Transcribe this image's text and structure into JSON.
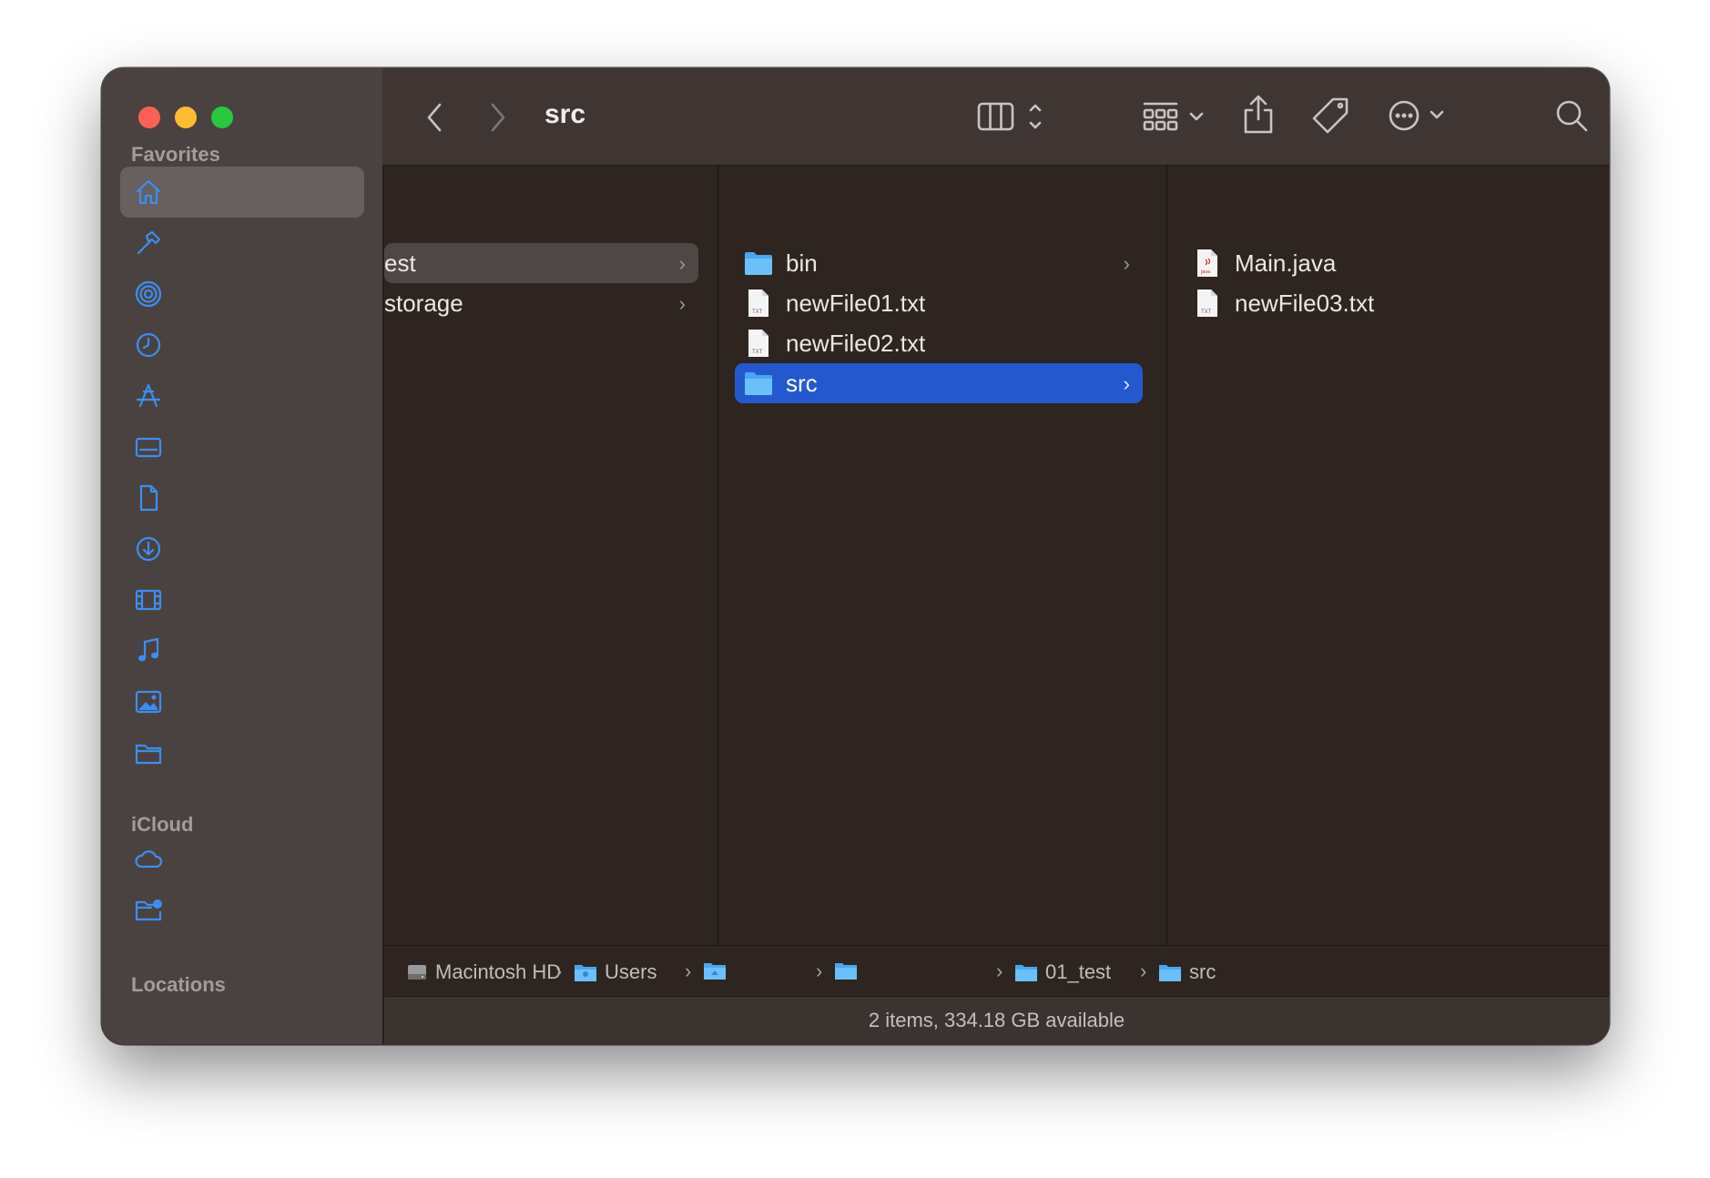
{
  "window": {
    "title": "src"
  },
  "sidebar": {
    "sections": {
      "favorites": "Favorites",
      "icloud": "iCloud",
      "locations": "Locations"
    },
    "favorites_icons": [
      "home-icon",
      "developer-hammer-icon",
      "airdrop-icon",
      "recents-clock-icon",
      "applications-icon",
      "desktop-icon",
      "documents-icon",
      "downloads-icon",
      "movies-icon",
      "music-icon",
      "pictures-icon",
      "folder-icon"
    ],
    "icloud_icons": [
      "icloud-drive-icon",
      "shared-folder-icon"
    ]
  },
  "toolbar": {
    "back": "back-chevron-icon",
    "forward": "forward-chevron-icon",
    "view_mode": "column-view-icon",
    "group": "group-grid-icon",
    "share": "share-icon",
    "tag": "tag-icon",
    "more": "more-ellipsis-icon",
    "search": "search-icon"
  },
  "columns": {
    "col1": [
      {
        "label": "est",
        "has_children": true,
        "selected": "inactive"
      },
      {
        "label": "storage",
        "has_children": true
      }
    ],
    "col2": [
      {
        "label": "bin",
        "type": "folder",
        "has_children": true
      },
      {
        "label": "newFile01.txt",
        "type": "txt"
      },
      {
        "label": "newFile02.txt",
        "type": "txt"
      },
      {
        "label": "src",
        "type": "folder",
        "has_children": true,
        "selected": "active"
      }
    ],
    "col3": [
      {
        "label": "Main.java",
        "type": "java"
      },
      {
        "label": "newFile03.txt",
        "type": "txt"
      }
    ]
  },
  "pathbar": {
    "items": [
      "Macintosh HD",
      "Users",
      "",
      "",
      "01_test",
      "src"
    ]
  },
  "status": {
    "text": "2 items, 334.18 GB available"
  },
  "colors": {
    "accent": "#3c8ef0",
    "selection": "#2458cf"
  }
}
